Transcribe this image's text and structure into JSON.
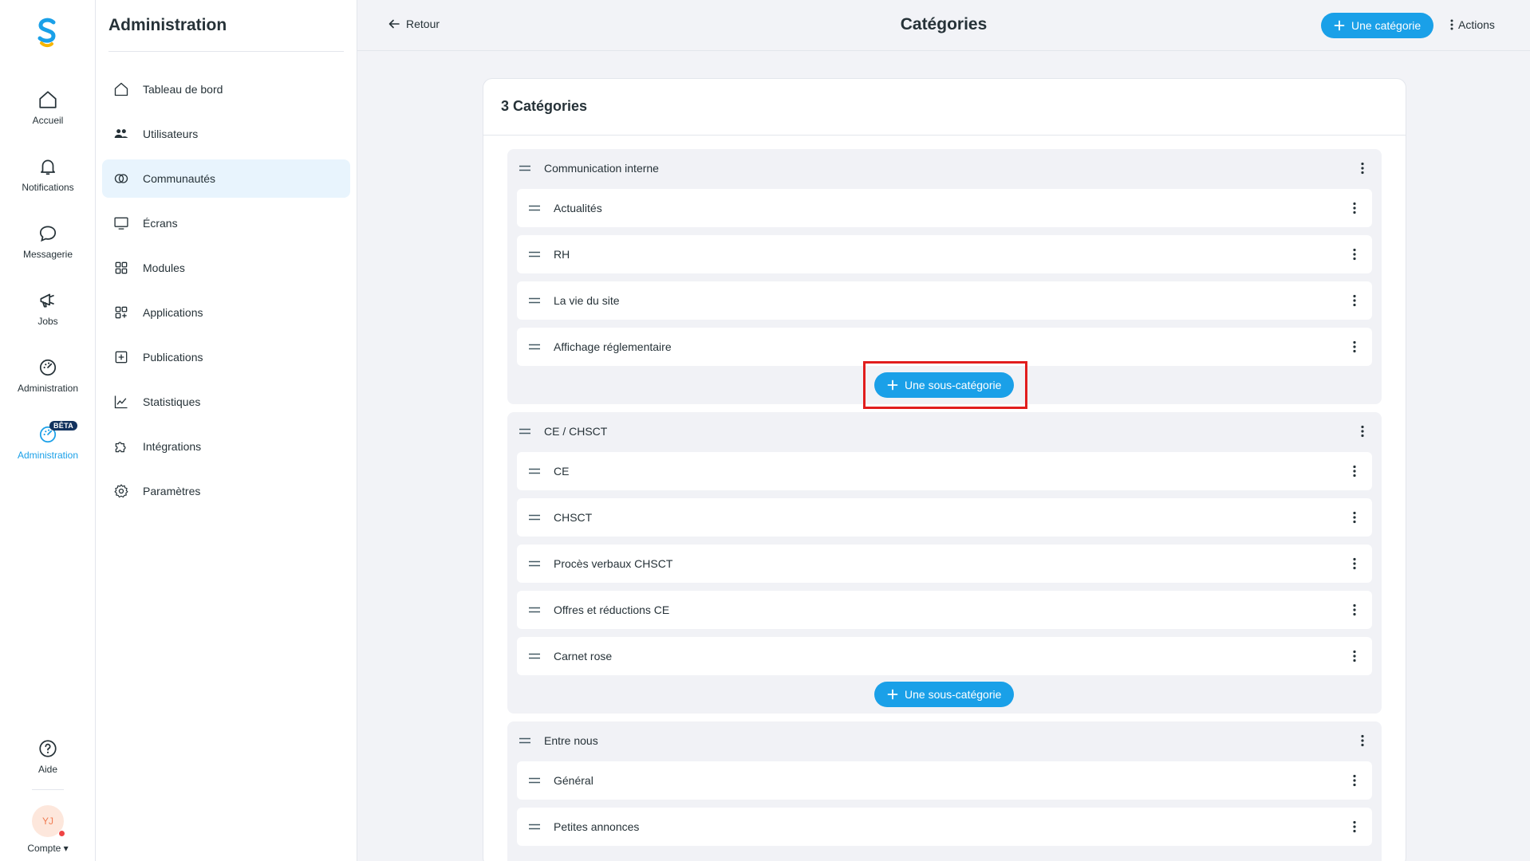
{
  "rail": {
    "items": [
      {
        "label": "Accueil",
        "icon": "home-icon"
      },
      {
        "label": "Notifications",
        "icon": "bell-icon"
      },
      {
        "label": "Messagerie",
        "icon": "chat-icon"
      },
      {
        "label": "Jobs",
        "icon": "megaphone-icon"
      },
      {
        "label": "Administration",
        "icon": "gauge-icon"
      },
      {
        "label": "Administration",
        "icon": "gauge-icon",
        "badge": "BÊTA",
        "active": true
      }
    ],
    "help_label": "Aide",
    "avatar_initials": "YJ",
    "account_label": "Compte ▾"
  },
  "sidebar": {
    "title": "Administration",
    "items": [
      {
        "label": "Tableau de bord",
        "icon": "home-icon"
      },
      {
        "label": "Utilisateurs",
        "icon": "users-icon"
      },
      {
        "label": "Communautés",
        "icon": "circles-icon",
        "active": true
      },
      {
        "label": "Écrans",
        "icon": "monitor-icon"
      },
      {
        "label": "Modules",
        "icon": "grid-icon"
      },
      {
        "label": "Applications",
        "icon": "apps-icon"
      },
      {
        "label": "Publications",
        "icon": "plus-square-icon"
      },
      {
        "label": "Statistiques",
        "icon": "chart-icon"
      },
      {
        "label": "Intégrations",
        "icon": "puzzle-icon"
      },
      {
        "label": "Paramètres",
        "icon": "gear-icon"
      }
    ]
  },
  "topbar": {
    "back_label": "Retour",
    "title": "Catégories",
    "add_category_label": "Une catégorie",
    "actions_label": "Actions"
  },
  "card": {
    "heading": "3 Catégories",
    "add_subcategory_label": "Une sous-catégorie",
    "groups": [
      {
        "name": "Communication interne",
        "items": [
          "Actualités",
          "RH",
          "La vie du site",
          "Affichage réglementaire"
        ]
      },
      {
        "name": "CE / CHSCT",
        "items": [
          "CE",
          "CHSCT",
          "Procès verbaux CHSCT",
          "Offres et réductions CE",
          "Carnet rose"
        ]
      },
      {
        "name": "Entre nous",
        "items": [
          "Général",
          "Petites annonces"
        ]
      }
    ]
  },
  "colors": {
    "accent": "#1aa0e8",
    "highlight": "#e11d1d",
    "active_nav_bg": "#e8f4fd"
  }
}
